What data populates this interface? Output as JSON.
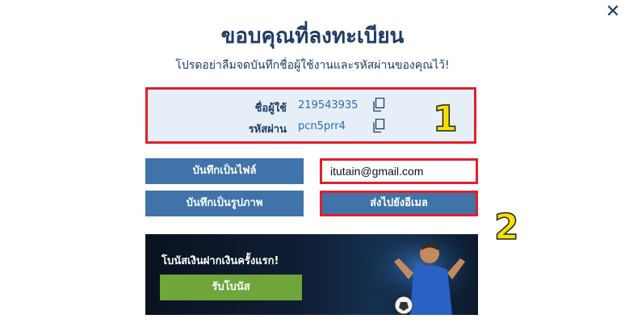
{
  "dialog": {
    "title": "ขอบคุณที่ลงทะเบียน",
    "subtitle": "โปรดอย่าลืมจดบันทึกชื่อผู้ใช้งานและรหัสผ่านของคุณไว้!",
    "close_icon": "close-icon"
  },
  "credentials": {
    "username_label": "ชื่อผู้ใช้",
    "username_value": "219543935",
    "password_label": "รหัสผ่าน",
    "password_value": "pcn5prr4",
    "copy_icon": "copy-icon"
  },
  "annotations": {
    "step1": "1",
    "step2": "2",
    "highlight_color": "#e0202a",
    "number_color": "#f5e100"
  },
  "actions": {
    "save_file_label": "บันทึกเป็นไฟล์",
    "save_image_label": "บันทึกเป็นรูปภาพ",
    "email_value": "itutain@gmail.com",
    "send_email_label": "ส่งไปยังอีเมล"
  },
  "banner": {
    "text": "โบนัสเงินฝากเงินครั้งแรก!",
    "button_label": "รับโบนัส"
  },
  "colors": {
    "primary": "#3f73aa",
    "title": "#1f3c63",
    "bonus_button": "#6fa53a"
  }
}
